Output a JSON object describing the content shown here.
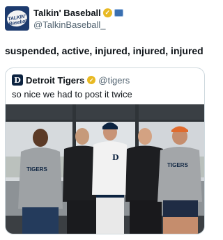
{
  "author": {
    "display_name": "Talkin' Baseball",
    "handle": "@TalkinBaseball_",
    "avatar_text": "TALKIN' Baseball",
    "verified_icon": "verified-badge-icon",
    "affiliate_icon": "affiliate-badge-icon"
  },
  "tweet": {
    "text": "suspended, active, injured, injured, injured"
  },
  "quoted": {
    "avatar_letter": "D",
    "display_name": "Detroit Tigers",
    "handle": "@tigers",
    "text": "so nice we had to post it twice",
    "photo_jersey_text": "TIGERS"
  },
  "colors": {
    "verified_gold": "#e8b923",
    "handle_gray": "#536471",
    "tigers_navy": "#0c2340"
  }
}
